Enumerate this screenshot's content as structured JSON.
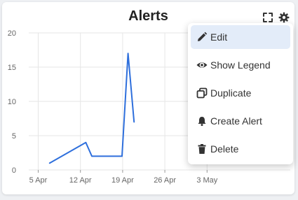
{
  "widget": {
    "title": "Alerts",
    "expand_icon": "expand-icon",
    "settings_icon": "gear-icon"
  },
  "colors": {
    "line": "#2e6fdc",
    "grid": "#e6e6e6",
    "axis_text": "#666666",
    "menu_active": "#e3ecf9"
  },
  "menu": {
    "items": [
      {
        "label": "Edit",
        "icon": "pencil-icon",
        "active": true
      },
      {
        "label": "Show Legend",
        "icon": "eye-icon",
        "active": false
      },
      {
        "label": "Duplicate",
        "icon": "copy-icon",
        "active": false
      },
      {
        "label": "Create Alert",
        "icon": "bell-icon",
        "active": false
      },
      {
        "label": "Delete",
        "icon": "trash-icon",
        "active": false
      }
    ]
  },
  "chart_data": {
    "type": "line",
    "title": "Alerts",
    "x_tick_labels": [
      "5 Apr",
      "12 Apr",
      "19 Apr",
      "26 Apr",
      "3 May"
    ],
    "y_ticks": [
      0,
      5,
      10,
      15,
      20
    ],
    "ylim": [
      0,
      20
    ],
    "grid": true,
    "series": [
      {
        "x": [
          "2024-04-08",
          "2024-04-14",
          "2024-04-15",
          "2024-04-20",
          "2024-04-21",
          "2024-04-22"
        ],
        "y": [
          1,
          4,
          2,
          2,
          17,
          7
        ]
      }
    ]
  }
}
